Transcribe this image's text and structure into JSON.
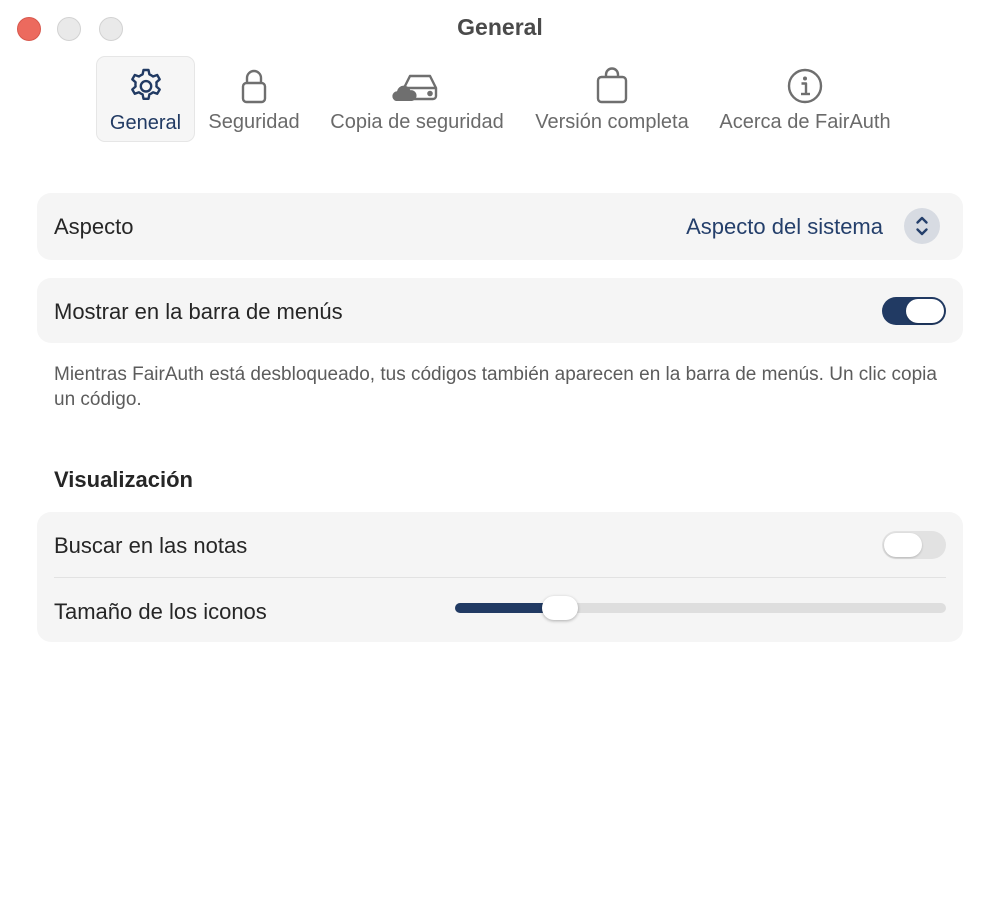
{
  "window": {
    "title": "General"
  },
  "toolbar": {
    "tabs": [
      {
        "label": "General",
        "icon": "gear-icon",
        "selected": true
      },
      {
        "label": "Seguridad",
        "icon": "lock-icon",
        "selected": false
      },
      {
        "label": "Copia de seguridad",
        "icon": "cloud-drive-icon",
        "selected": false
      },
      {
        "label": "Versión completa",
        "icon": "shopping-bag-icon",
        "selected": false
      },
      {
        "label": "Acerca de FairAuth",
        "icon": "info-icon",
        "selected": false
      }
    ]
  },
  "appearance": {
    "label": "Aspecto",
    "value": "Aspecto del sistema"
  },
  "menubar": {
    "label": "Mostrar en la barra de menús",
    "enabled": true,
    "note": "Mientras FairAuth está desbloqueado, tus códigos también aparecen en la barra de menús. Un clic copia un código."
  },
  "display": {
    "section_title": "Visualización",
    "search_notes": {
      "label": "Buscar en las notas",
      "enabled": false
    },
    "icon_size": {
      "label": "Tamaño de los iconos",
      "value_fraction": 0.19
    }
  },
  "colors": {
    "accent": "#213a63",
    "close_button": "#ec6a5e"
  }
}
